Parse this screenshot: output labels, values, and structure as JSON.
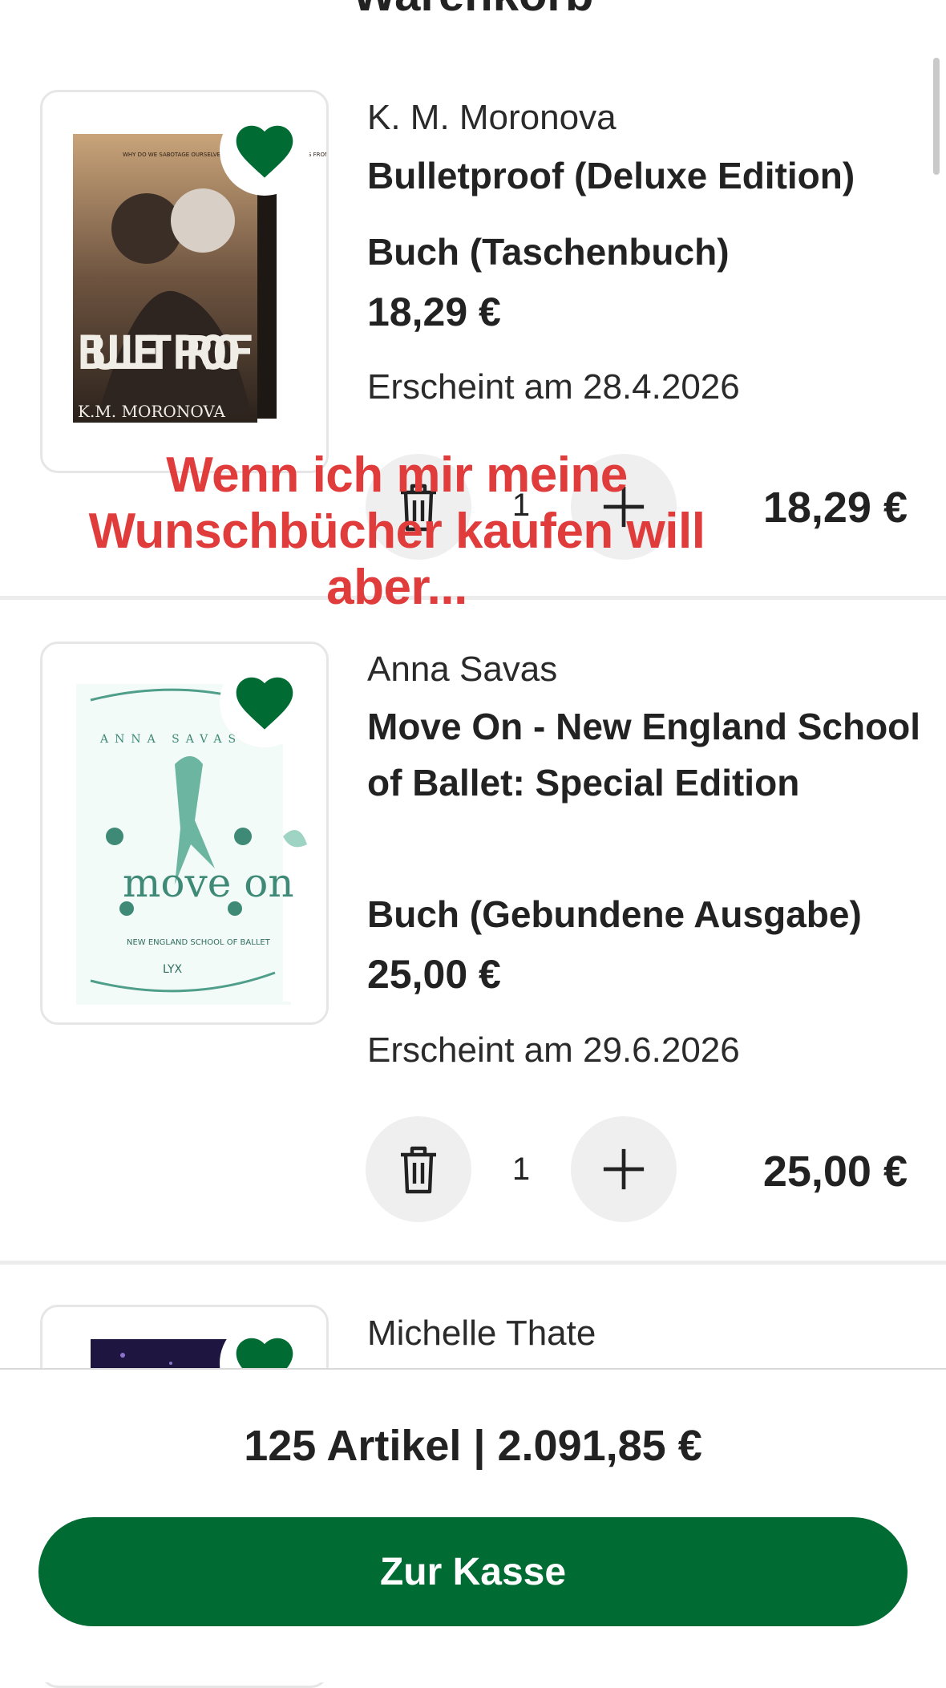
{
  "header": {
    "title": "Warenkorb"
  },
  "items": [
    {
      "author": "K. M. Moronova",
      "title": "Bulletproof (Deluxe Edition)",
      "format": "Buch (Taschenbuch)",
      "price": "18,29 €",
      "release": "Erscheint am 28.4.2026",
      "quantity": "1",
      "line_total": "18,29 €",
      "cover": {
        "title": "BULLET PROOF",
        "author": "K.M. MORONOVA",
        "tagline": "WHY DO WE SABOTAGE OURSELVES WITH THE SOFTEST OF KISSES FROM THE DEADLIEST VILLAINS?"
      }
    },
    {
      "author": "Anna Savas",
      "title": "Move On - New England School of Ballet: Special Edition",
      "format": "Buch (Gebundene Ausgabe)",
      "price": "25,00 €",
      "release": "Erscheint am 29.6.2026",
      "quantity": "1",
      "line_total": "25,00 €",
      "cover": {
        "title": "move on",
        "author": "ANNA SAVAS",
        "subtitle": "NEW ENGLAND SCHOOL OF BALLET",
        "publisher": "LYX"
      }
    },
    {
      "author": "Michelle Thate"
    }
  ],
  "overlay_caption": "Wenn ich mir meine Wunschbücher kaufen will aber...",
  "footer": {
    "summary": "125 Artikel | 2.091,85 €",
    "checkout_label": "Zur Kasse"
  },
  "colors": {
    "accent": "#006b32",
    "caption": "#e03c3c"
  },
  "icons": [
    "heart-icon",
    "trash-icon",
    "plus-icon"
  ]
}
